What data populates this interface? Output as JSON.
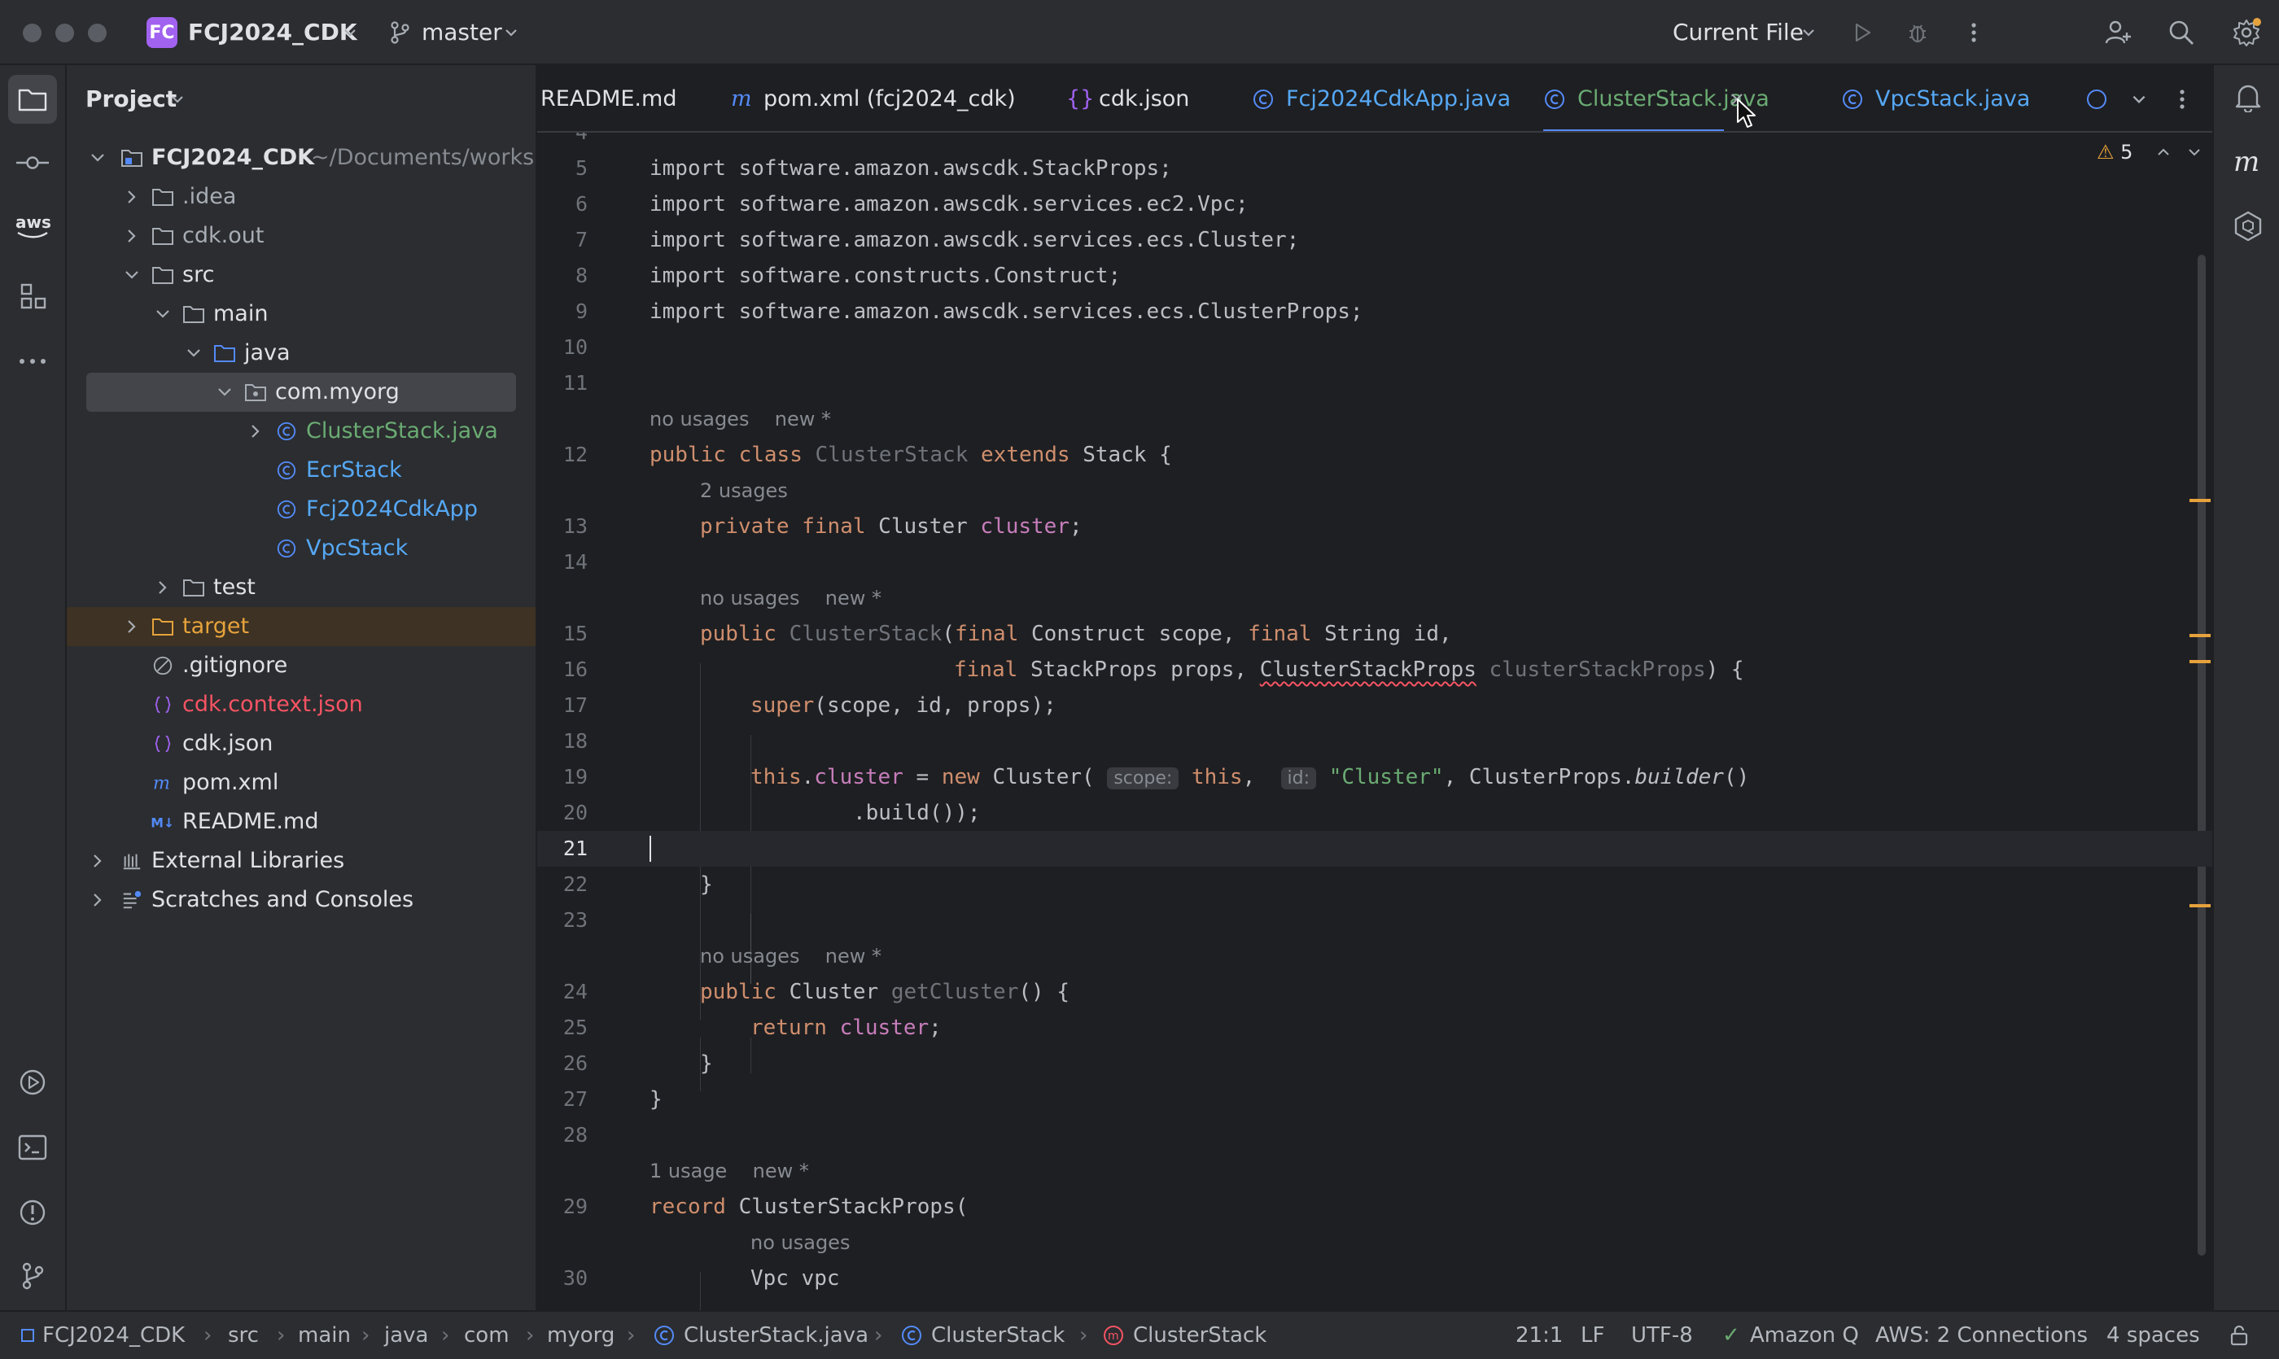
{
  "titlebar": {
    "project_badge": "FC",
    "project_name": "FCJ2024_CDK",
    "branch": "master",
    "run_config": "Current File"
  },
  "project_panel": {
    "title": "Project",
    "root_name": "FCJ2024_CDK",
    "root_path": "~/Documents/workshop",
    "items": [
      {
        "label": ".idea"
      },
      {
        "label": "cdk.out"
      },
      {
        "label": "src"
      },
      {
        "label": "main"
      },
      {
        "label": "java"
      },
      {
        "label": "com.myorg"
      },
      {
        "label": "ClusterStack.java"
      },
      {
        "label": "EcrStack"
      },
      {
        "label": "Fcj2024CdkApp"
      },
      {
        "label": "VpcStack"
      },
      {
        "label": "test"
      },
      {
        "label": "target"
      },
      {
        "label": ".gitignore"
      },
      {
        "label": "cdk.context.json"
      },
      {
        "label": "cdk.json"
      },
      {
        "label": "pom.xml"
      },
      {
        "label": "README.md"
      },
      {
        "label": "External Libraries"
      },
      {
        "label": "Scratches and Consoles"
      }
    ]
  },
  "tabs": [
    {
      "label": "README.md"
    },
    {
      "label": "pom.xml (fcj2024_cdk)"
    },
    {
      "label": "cdk.json"
    },
    {
      "label": "Fcj2024CdkApp.java"
    },
    {
      "label": "ClusterStack.java"
    },
    {
      "label": "VpcStack.java"
    }
  ],
  "editor": {
    "warning_count": "5",
    "lines": [
      {
        "n": "4"
      },
      {
        "n": "5",
        "code": "import software.amazon.awscdk.StackProps;"
      },
      {
        "n": "6",
        "code": "import software.amazon.awscdk.services.ec2.Vpc;"
      },
      {
        "n": "7",
        "code": "import software.amazon.awscdk.services.ecs.Cluster;"
      },
      {
        "n": "8",
        "code": "import software.constructs.Construct;"
      },
      {
        "n": "9",
        "code": "import software.amazon.awscdk.services.ecs.ClusterProps;"
      },
      {
        "n": "10"
      },
      {
        "n": "11"
      },
      {
        "n": "12"
      },
      {
        "n": "13"
      },
      {
        "n": "14"
      },
      {
        "n": "15"
      },
      {
        "n": "16"
      },
      {
        "n": "17"
      },
      {
        "n": "18"
      },
      {
        "n": "19"
      },
      {
        "n": "20"
      },
      {
        "n": "21"
      },
      {
        "n": "22"
      },
      {
        "n": "23"
      },
      {
        "n": "24"
      },
      {
        "n": "25"
      },
      {
        "n": "26"
      },
      {
        "n": "27"
      },
      {
        "n": "28"
      },
      {
        "n": "29"
      },
      {
        "n": "30"
      }
    ],
    "hints": {
      "no_usages": "no usages",
      "new": "new *",
      "two_usages": "2 usages",
      "one_usage": "1 usage"
    },
    "tokens": {
      "public": "public",
      "class": "class",
      "extends": "extends",
      "private": "private",
      "final": "final",
      "super": "super",
      "this": "this",
      "new": "new",
      "return": "return",
      "record": "record",
      "ClusterStack": "ClusterStack",
      "Stack": "Stack",
      "Cluster": "Cluster",
      "Construct": "Construct",
      "String": "String",
      "StackProps": "StackProps",
      "ClusterStackProps": "ClusterStackProps",
      "ClusterProps": "ClusterProps",
      "Vpc": "Vpc",
      "cluster": "cluster",
      "scope": "scope",
      "id": "id",
      "props": "props",
      "clusterStackProps": "clusterStackProps",
      "vpc": "vpc",
      "builder": "builder",
      "build": "build",
      "getCluster": "getCluster",
      "string_cluster": "\"Cluster\"",
      "inlay_scope": "scope:",
      "inlay_id": "id:"
    }
  },
  "statusbar": {
    "breadcrumbs": [
      "FCJ2024_CDK",
      "src",
      "main",
      "java",
      "com",
      "myorg",
      "ClusterStack.java",
      "ClusterStack",
      "ClusterStack"
    ],
    "position": "21:1",
    "line_ending": "LF",
    "encoding": "UTF-8",
    "amazon_q": "Amazon Q",
    "aws": "AWS: 2 Connections",
    "indent": "4 spaces"
  },
  "colors": {
    "accent_blue": "#548af7",
    "keyword": "#cf8e6d",
    "string": "#6aab73",
    "field": "#c77dbb",
    "function": "#56a8f5",
    "warning": "#e6a23c",
    "error_text": "#f75464"
  }
}
